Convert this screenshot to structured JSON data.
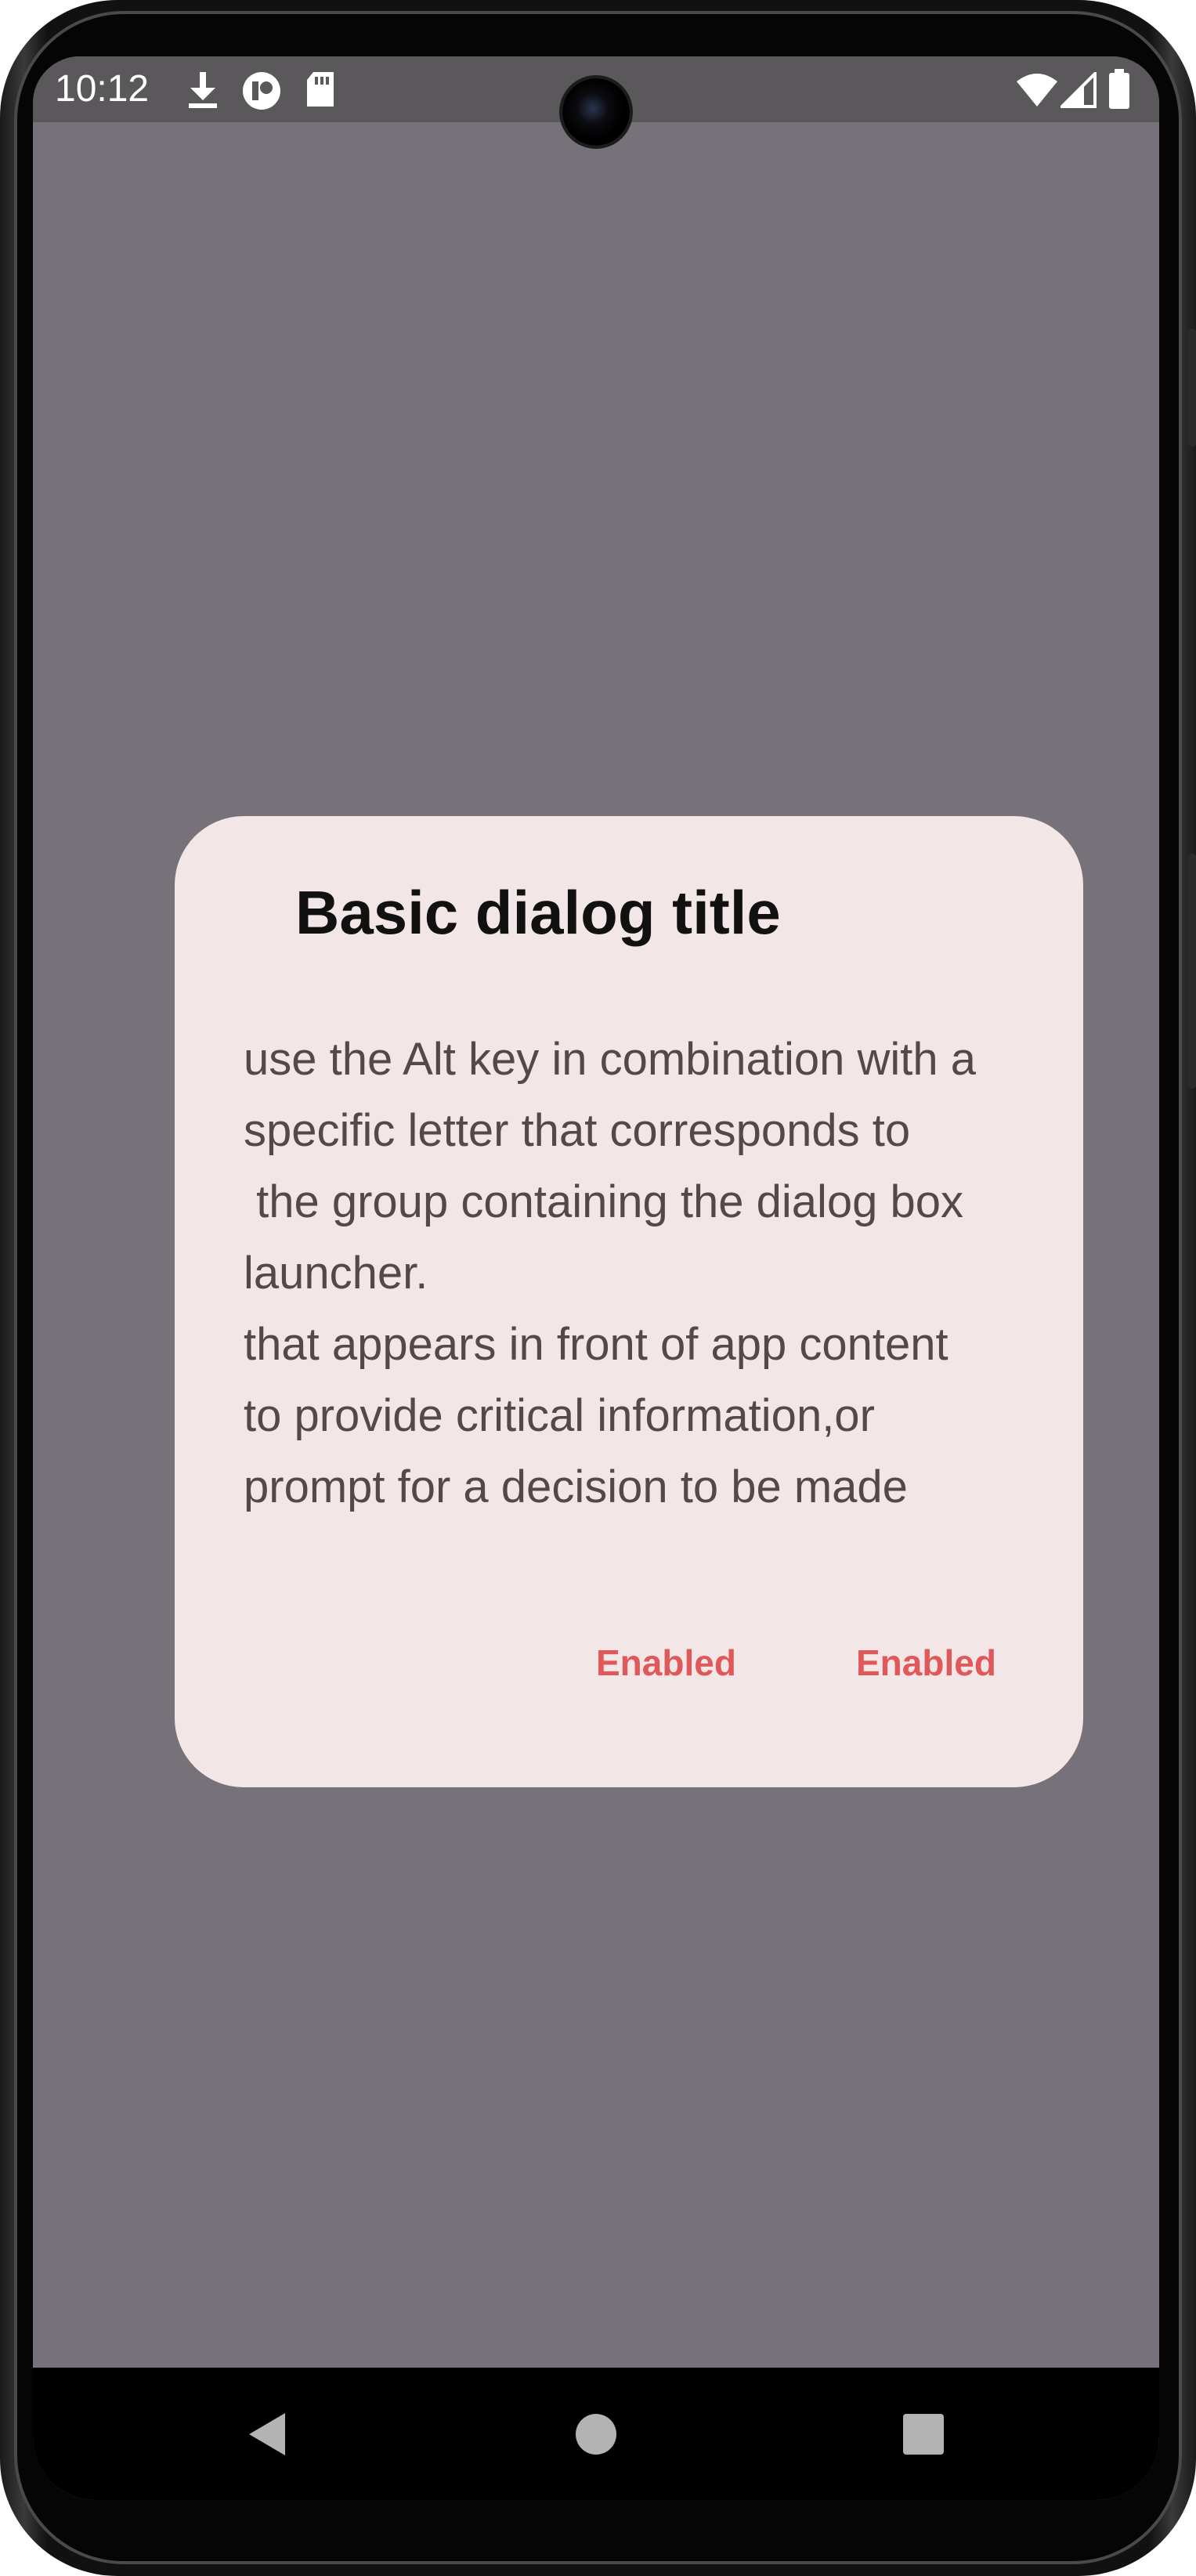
{
  "status_bar": {
    "time": "10:12",
    "left_icons": [
      "download-icon",
      "app-notification-icon",
      "sd-card-icon"
    ],
    "right_icons": [
      "wifi-icon",
      "signal-icon",
      "battery-icon"
    ]
  },
  "dialog": {
    "title": "Basic dialog title",
    "body_lines": [
      "use the Alt key in combination with a",
      "specific letter that corresponds to",
      " the group containing the dialog box",
      "launcher.",
      "that appears in front of app content",
      "to provide critical information,or",
      "prompt for a decision to be made"
    ],
    "actions": [
      {
        "label": "Enabled"
      },
      {
        "label": "Enabled"
      }
    ]
  },
  "nav_bar": {
    "buttons": [
      "back-icon",
      "home-icon",
      "recents-icon"
    ]
  },
  "colors": {
    "scrim": "#77727a",
    "dialog_surface": "#f2e6e6",
    "action_text": "#e0585a",
    "body_text": "#54484a"
  }
}
